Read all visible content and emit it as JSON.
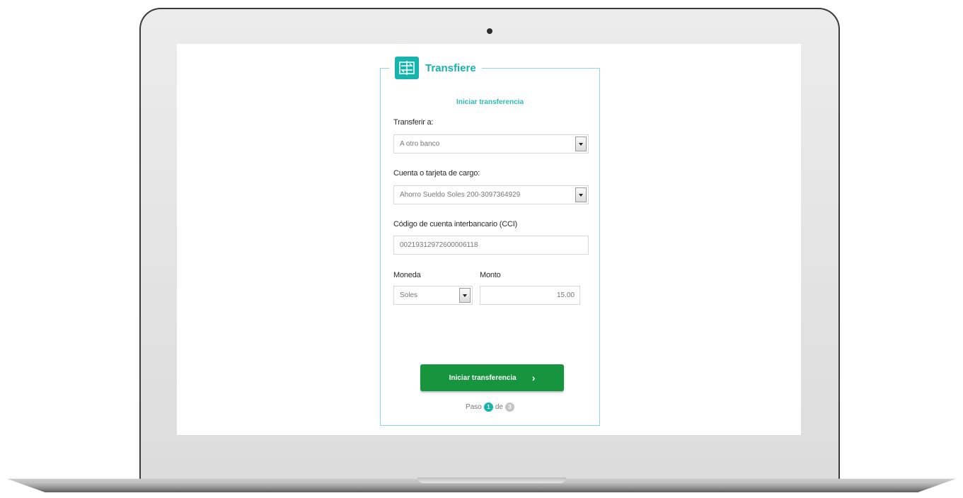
{
  "app": {
    "title": "Transfiere",
    "subtitle": "Iniciar transferencia"
  },
  "form": {
    "transfer_to": {
      "label": "Transferir a:",
      "value": "A otro banco"
    },
    "charge_account": {
      "label": "Cuenta o tarjeta de cargo:",
      "value": "Ahorro Sueldo Soles 200-3097364929"
    },
    "cci": {
      "label": "Código de cuenta interbancario (CCI)",
      "value": "00219312972600006118"
    },
    "currency": {
      "label": "Moneda",
      "value": "Soles"
    },
    "amount": {
      "label": "Monto",
      "value": "15.00"
    }
  },
  "button": {
    "label": "Iniciar transferencia",
    "chevron": "›"
  },
  "steps": {
    "prefix": "Paso",
    "current": "1",
    "separator": "de",
    "total": "3"
  },
  "colors": {
    "brand_teal": "#17b3ad",
    "button_green": "#17943e",
    "card_border": "#8ed8d6"
  },
  "icons": {
    "logo": "transfer-arrows-icon",
    "dropdown": "chevron-down-icon",
    "button": "chevron-right-icon"
  }
}
